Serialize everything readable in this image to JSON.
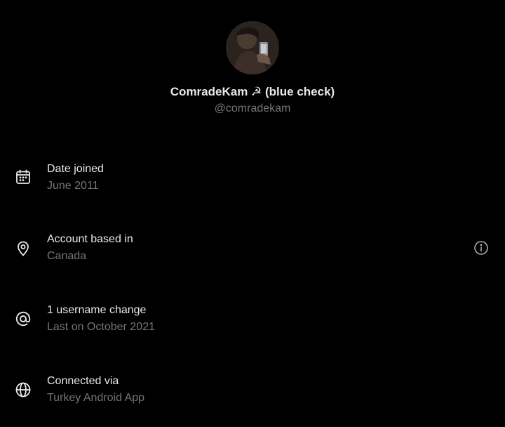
{
  "profile": {
    "display_name": "ComradeKam ☭ (blue check)",
    "handle": "@comradekam"
  },
  "about": {
    "rows": [
      {
        "icon": "calendar-icon",
        "title": "Date joined",
        "value": "June 2011"
      },
      {
        "icon": "location-pin-icon",
        "title": "Account based in",
        "value": "Canada"
      },
      {
        "icon": "at-sign-icon",
        "title": "1 username change",
        "value": "Last on October 2021"
      },
      {
        "icon": "globe-icon",
        "title": "Connected via",
        "value": "Turkey Android App"
      }
    ]
  },
  "colors": {
    "background": "#000000",
    "primary_text": "#e7e9ea",
    "secondary_text": "#71767b"
  }
}
